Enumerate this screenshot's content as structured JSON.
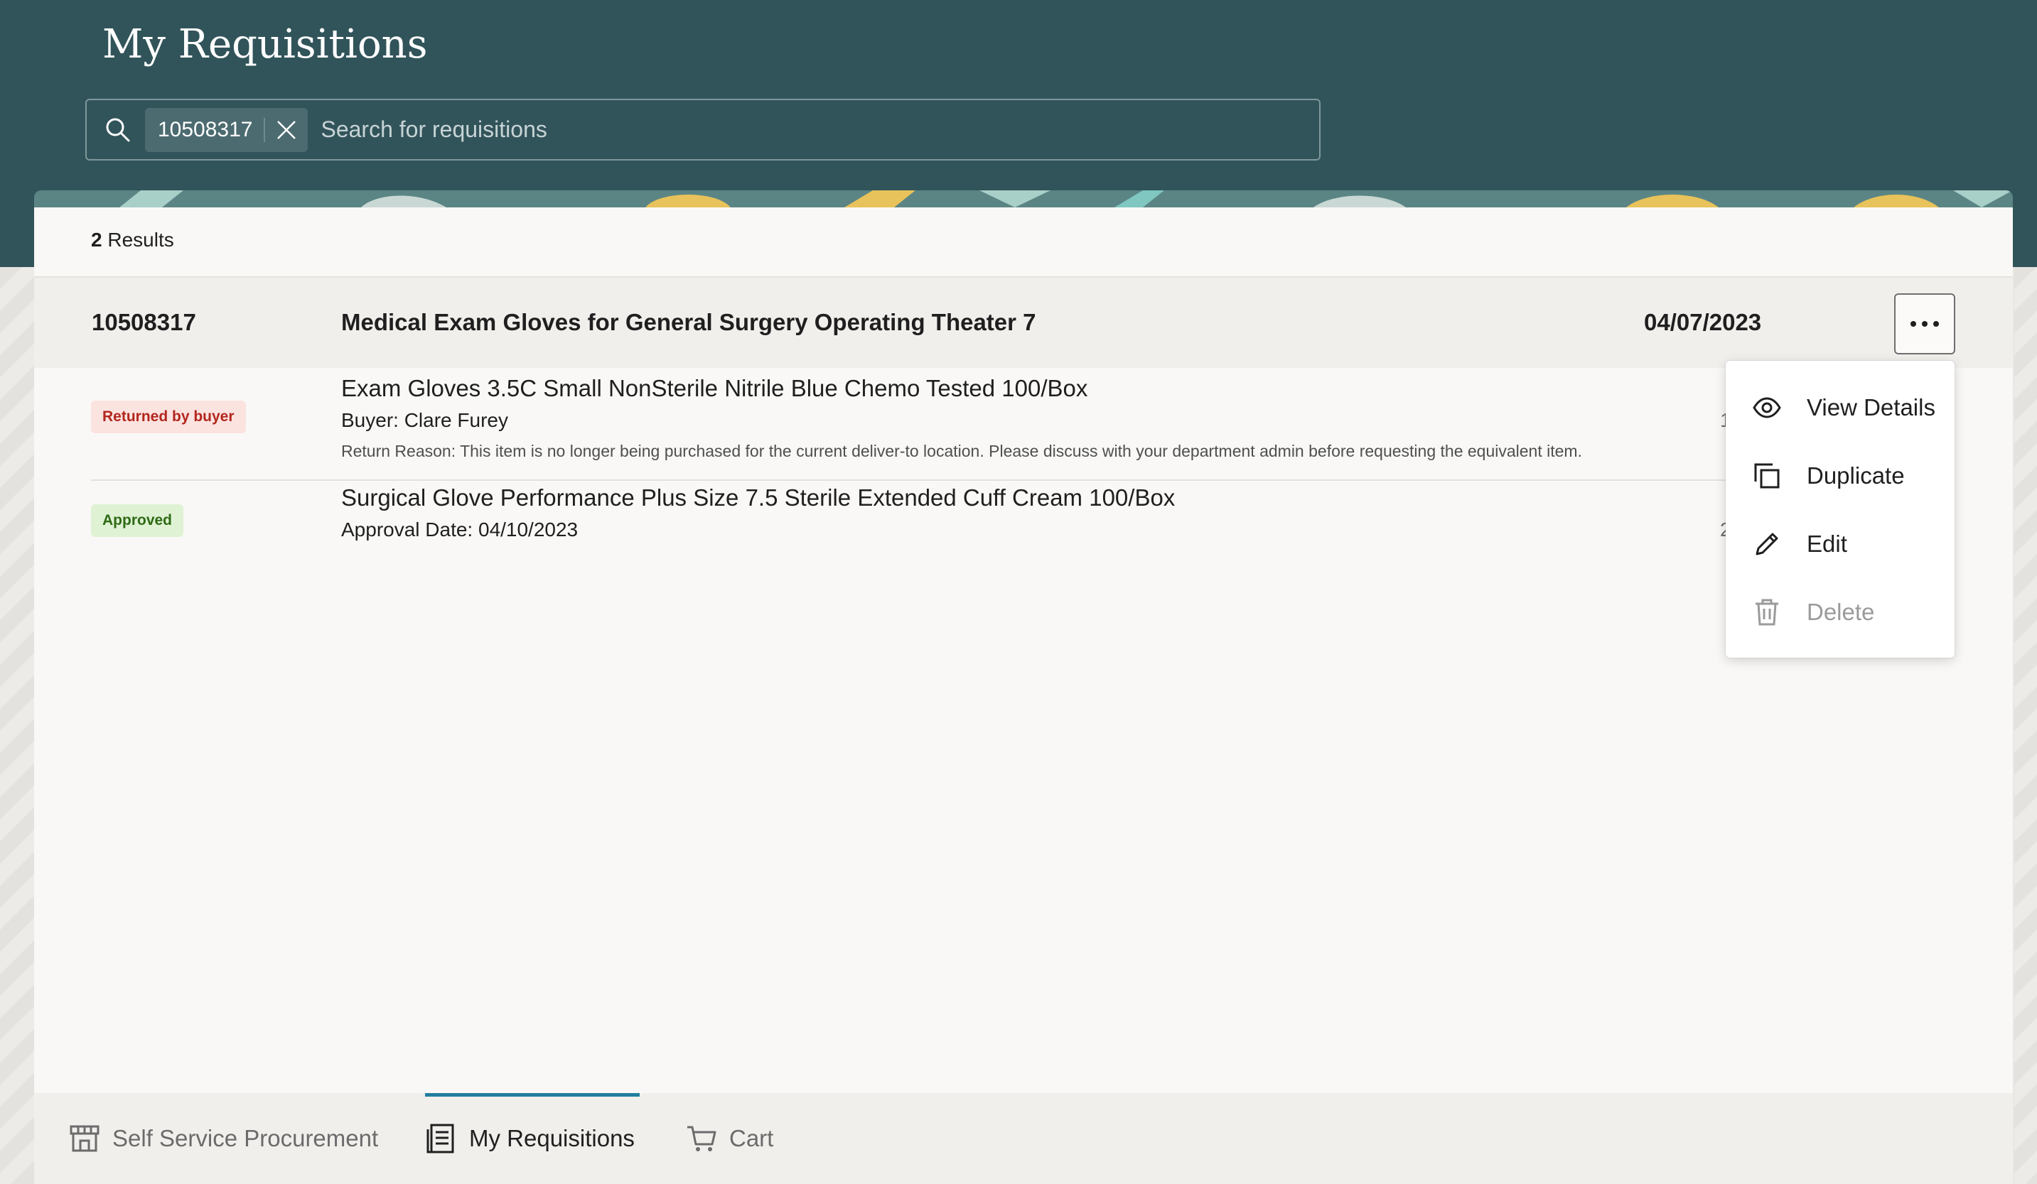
{
  "header": {
    "title": "My Requisitions",
    "search": {
      "chip_value": "10508317",
      "placeholder": "Search for requisitions"
    }
  },
  "results": {
    "count": "2",
    "label": "Results"
  },
  "requisition": {
    "number": "10508317",
    "title": "Medical Exam Gloves for General Surgery Operating Theater 7",
    "date": "04/07/2023",
    "lines": [
      {
        "status": "Returned by buyer",
        "description": "Exam Gloves 3.5C Small NonSterile Nitrile Blue Chemo Tested 100/Box",
        "detail": "Buyer: Clare Furey",
        "note": "Return Reason: This item is no longer being purchased for the current deliver-to location. Please discuss with your department admin before requesting the equivalent item.",
        "quantity": "1"
      },
      {
        "status": "Approved",
        "description": "Surgical Glove Performance Plus Size 7.5 Sterile Extended Cuff Cream 100/Box",
        "detail": "Approval Date: 04/10/2023",
        "quantity": "2"
      }
    ]
  },
  "actions_menu": {
    "items": [
      {
        "label": "View Details",
        "icon": "eye-icon",
        "enabled": true
      },
      {
        "label": "Duplicate",
        "icon": "duplicate-icon",
        "enabled": true
      },
      {
        "label": "Edit",
        "icon": "pencil-icon",
        "enabled": true
      },
      {
        "label": "Delete",
        "icon": "trash-icon",
        "enabled": false
      }
    ]
  },
  "bottom_nav": {
    "tabs": [
      {
        "label": "Self Service Procurement",
        "icon": "store-icon"
      },
      {
        "label": "My Requisitions",
        "icon": "requisition-list-icon",
        "active": true
      },
      {
        "label": "Cart",
        "icon": "cart-icon"
      }
    ]
  },
  "colors": {
    "header_bg": "#31545a",
    "returned_badge_bg": "#fbe3e0",
    "returned_badge_text": "#b2271d",
    "approved_badge_bg": "#dff2d4",
    "approved_badge_text": "#2f6a14",
    "active_tab_indicator": "#227e9e"
  }
}
